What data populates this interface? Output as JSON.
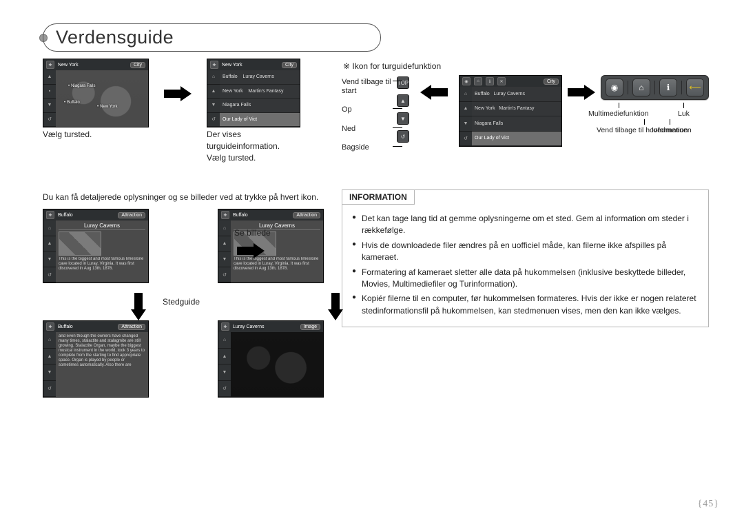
{
  "title": "Verdensguide",
  "top": {
    "shot1_caption": "Vælg tursted.",
    "shot2_caption": "Der vises turguideinformation. Vælg tursted.",
    "shot1_title": "New York",
    "shot1_tag": "City",
    "shot1_places": [
      "Niagara Falls",
      "Buffalo",
      "New York"
    ],
    "shot2_title": "New York",
    "shot2_tag": "City",
    "shot2_list": [
      "Buffalo",
      "Luray Caverns",
      "New York",
      "Martin's Fantasy",
      "Niagara Falls",
      "Our Lady of Vict"
    ]
  },
  "icons": {
    "heading": "Ikon for turguidefunktion",
    "left": [
      "Vend tilbage til start",
      "Op",
      "Ned",
      "Bagside"
    ],
    "bar": [
      "Multimediefunktion",
      "Vend tilbage til hovedmenuen",
      "Information",
      "Luk"
    ],
    "shot_title": "New York",
    "shot_tag": "City",
    "shot_list": [
      "Buffalo",
      "Luray Caverns",
      "New York",
      "Martin's Fantasy",
      "Niagara Falls",
      "Our Lady of Vict"
    ]
  },
  "mid_sentence": "Du kan få detaljerede oplysninger og se billeder ved at trykke på hvert ikon.",
  "side": {
    "se_billede": "Se billede",
    "stedguide": "Stedguide"
  },
  "detail": {
    "shotA_title": "Buffalo",
    "shotA_tag": "Attraction",
    "shotA_place": "Luray Caverns",
    "shotA_desc": "This is the biggest and most famous limestone cave located in Luray, Virginia. It was first discovered in Aug 13th, 1878.",
    "shotB_title": "Buffalo",
    "shotB_tag": "Attraction",
    "shotB_place": "Luray Caverns",
    "shotB_desc": "This is the biggest and most famous limestone cave located in Luray, Virginia. It was first discovered in Aug 13th, 1878.",
    "shotC_title": "Buffalo",
    "shotC_tag": "Attraction",
    "shotC_desc": "and even though the owners have changed many times, stalactite and stalagmite are still growing. Stalactite Organ, maybe the biggest musical instrument in the world, took 3 years to complete from the starting to find appropriate space. Organ is played by people or sometimes automatically. Also there are",
    "shotD_title": "Luray Caverns",
    "shotD_tag": "Image"
  },
  "info": {
    "title": "INFORMATION",
    "items": [
      "Det kan tage lang tid at gemme oplysningerne om et sted. Gem al information om steder i rækkefølge.",
      "Hvis de downloadede filer ændres på en uofficiel måde, kan filerne ikke afspilles på kameraet.",
      "Formatering af kameraet sletter alle data på hukommelsen (inklusive beskyttede billeder, Movies, Multimediefiler og Turinformation).",
      "Kopiér filerne til en computer, før hukommelsen formateres. Hvis der ikke er nogen relateret stedinformationsfil på hukommelsen, kan stedmenuen vises, men den kan ikke vælges."
    ]
  },
  "page_number": "{45}"
}
